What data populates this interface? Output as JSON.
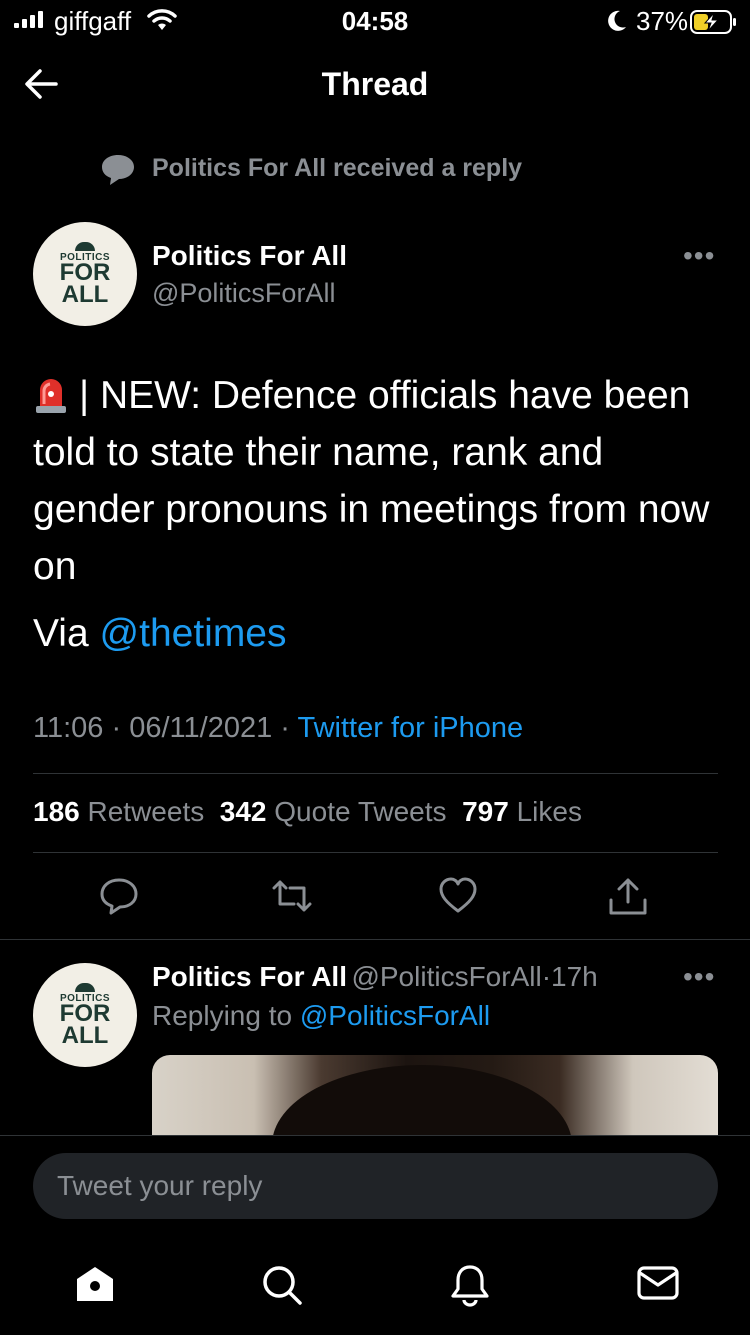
{
  "status_bar": {
    "carrier": "giffgaff",
    "time": "04:58",
    "battery": "37%"
  },
  "header": {
    "title": "Thread"
  },
  "social_context": "Politics For All received a reply",
  "main_tweet": {
    "author_name": "Politics For All",
    "author_handle": "@PoliticsForAll",
    "avatar": {
      "line1": "POLITICS",
      "line2": "FOR",
      "line3": "ALL"
    },
    "text_lead": "| NEW: Defence officials have been told to state their name, rank and gender pronouns in meetings from now on",
    "via_prefix": "Via",
    "via_link": "@thetimes",
    "time": "11:06",
    "date": "06/11/2021",
    "source": "Twitter for iPhone",
    "retweets": "186",
    "retweets_label": "Retweets",
    "quotes": "342",
    "quotes_label": "Quote Tweets",
    "likes": "797",
    "likes_label": "Likes"
  },
  "reply_tweet": {
    "author_name": "Politics For All",
    "author_handle": "@PoliticsForAll",
    "age": "17h",
    "replying_prefix": "Replying to",
    "replying_to": "@PoliticsForAll"
  },
  "composer": {
    "placeholder": "Tweet your reply"
  },
  "colors": {
    "background": "#000000",
    "accent": "#1d9bf0",
    "secondary_text": "#8b8f94"
  }
}
